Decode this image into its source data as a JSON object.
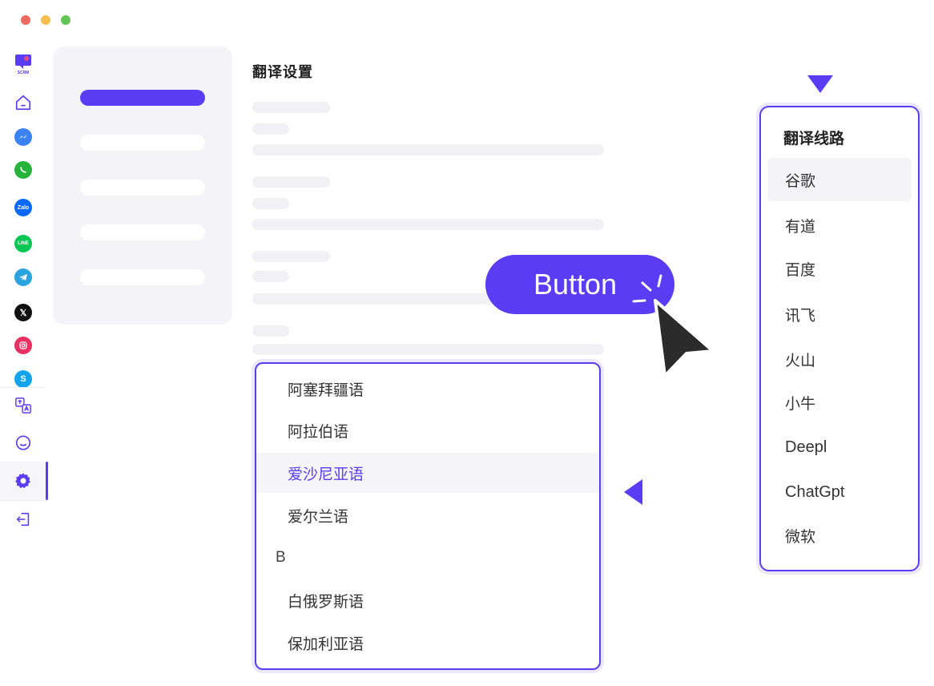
{
  "window": {
    "dots": [
      "#ec6a5e",
      "#f4bf4f",
      "#61c554"
    ]
  },
  "rail": {
    "logo_text": "SCRM",
    "items": [
      {
        "name": "home-icon"
      },
      {
        "name": "messenger-icon",
        "color": "#3b82f6"
      },
      {
        "name": "whatsapp-icon",
        "color": "#25b33b"
      },
      {
        "name": "zalo-icon",
        "color": "#0a68ff",
        "text": "Zalo"
      },
      {
        "name": "line-icon",
        "color": "#06c755",
        "text": "LINE"
      },
      {
        "name": "telegram-icon",
        "color": "#2aa3df"
      },
      {
        "name": "x-icon",
        "color": "#111111",
        "text": "𝕏"
      },
      {
        "name": "instagram-icon",
        "color": "#ec2f62"
      },
      {
        "name": "skype-icon",
        "color": "#12a5ee",
        "text": "S"
      },
      {
        "name": "translate-icon"
      },
      {
        "name": "chat-bubble-icon"
      },
      {
        "name": "settings-gear-icon",
        "active": true
      },
      {
        "name": "logout-icon"
      }
    ]
  },
  "nav_panel": {
    "active_index": 0
  },
  "main": {
    "title": "翻译设置"
  },
  "button": {
    "label": "Button"
  },
  "language_dropdown": {
    "items": [
      {
        "label": "阿塞拜疆语",
        "type": "item"
      },
      {
        "label": "阿拉伯语",
        "type": "item"
      },
      {
        "label": "爱沙尼亚语",
        "type": "item",
        "selected": true
      },
      {
        "label": "爱尔兰语",
        "type": "item"
      },
      {
        "label": "B",
        "type": "group"
      },
      {
        "label": "白俄罗斯语",
        "type": "item"
      },
      {
        "label": "保加利亚语",
        "type": "item"
      }
    ]
  },
  "route_list": {
    "title": "翻译线路",
    "items": [
      "谷歌",
      "有道",
      "百度",
      "讯飞",
      "火山",
      "小牛",
      "Deepl",
      "ChatGpt",
      "微软"
    ],
    "highlighted_index": 0
  },
  "colors": {
    "accent": "#5b3cf5",
    "panel": "#f4f4f8",
    "skeleton": "#f0f0f5"
  }
}
